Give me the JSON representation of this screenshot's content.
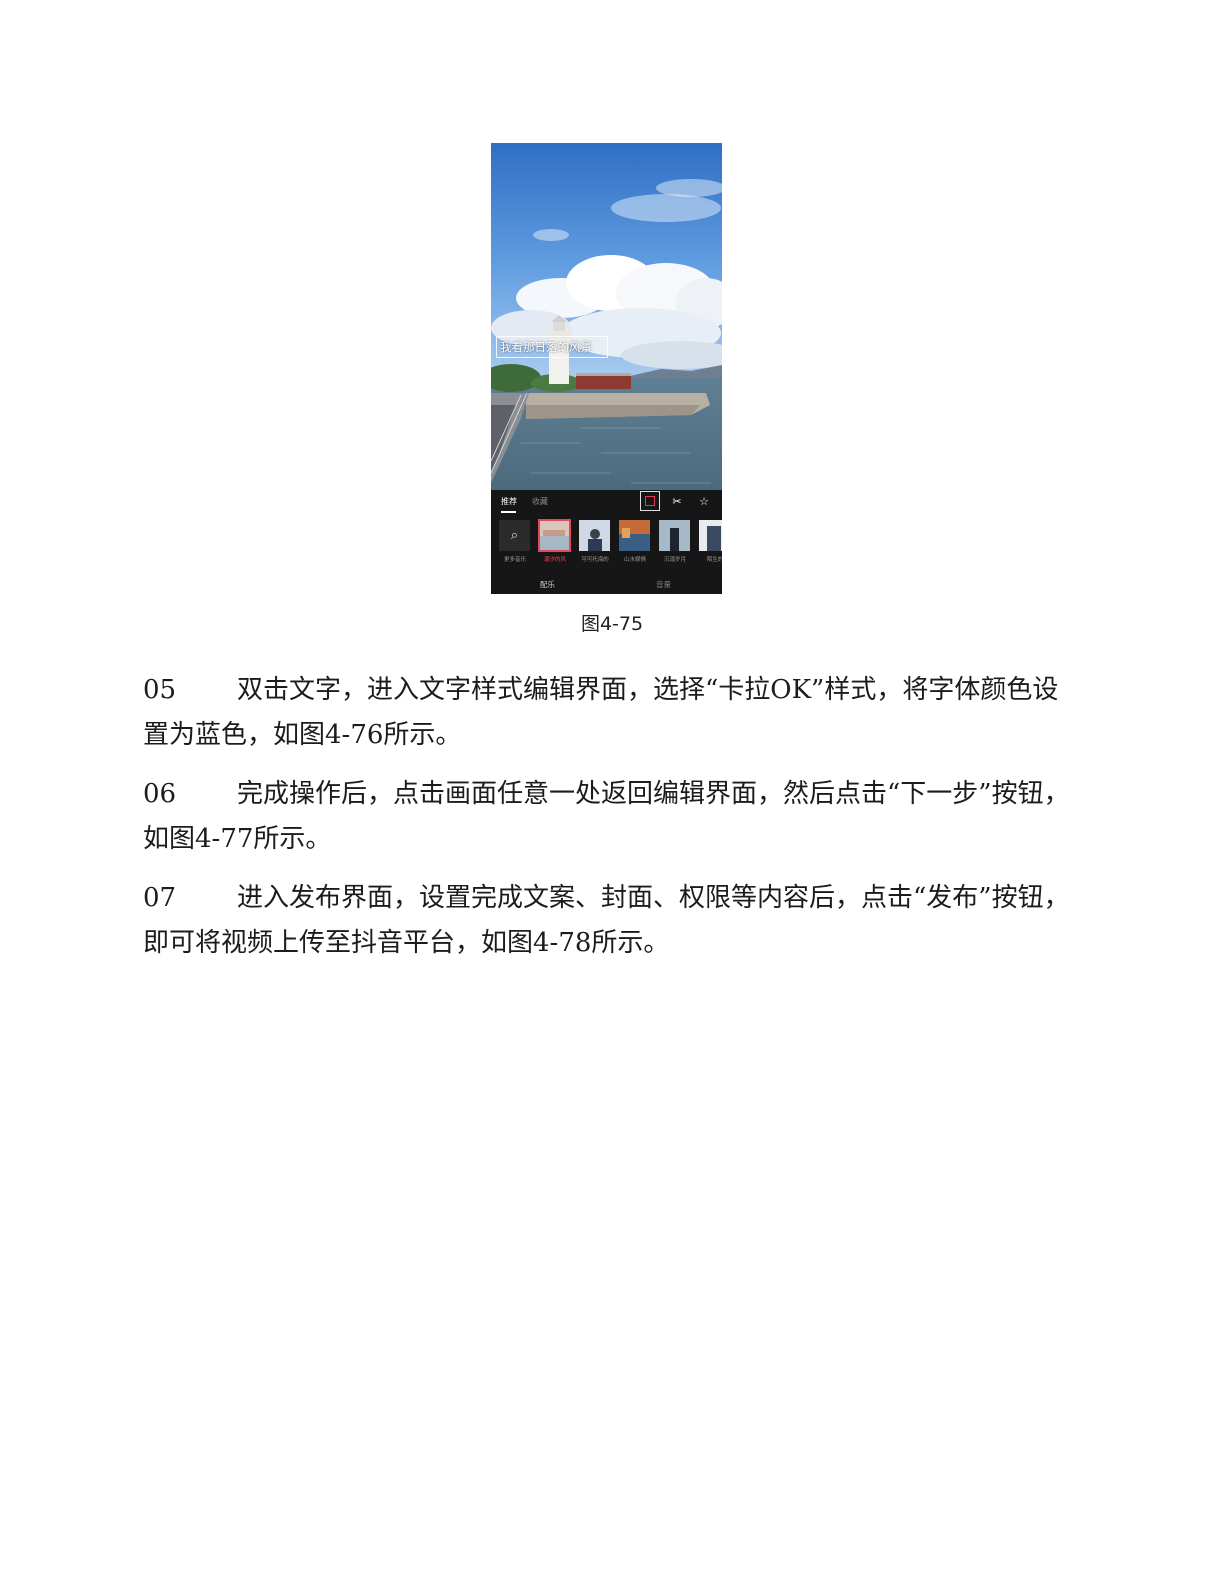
{
  "figure": {
    "caption": "图4-75",
    "screen": {
      "video_text": "我看那日落的风景",
      "tabs": [
        "推荐",
        "收藏"
      ],
      "tool_icons": [
        "color-icon",
        "scissors-icon",
        "star-icon"
      ],
      "music_items": [
        {
          "label": "更多音乐",
          "kind": "search"
        },
        {
          "label": "潮汐的风",
          "kind": "thumb",
          "selected": true
        },
        {
          "label": "可可托海的",
          "kind": "thumb"
        },
        {
          "label": "山水娱情",
          "kind": "thumb"
        },
        {
          "label": "沉溺岁月",
          "kind": "thumb"
        },
        {
          "label": "陌生的",
          "kind": "thumb"
        }
      ],
      "bottom_tabs": [
        "配乐",
        "音量"
      ],
      "accent_color": "#e24a5a"
    }
  },
  "paragraphs": [
    {
      "num": "05",
      "text": "双击文字，进入文字样式编辑界面，选择“卡拉OK”样式，将字体颜色设置为蓝色，如图4-76所示。"
    },
    {
      "num": "06",
      "text": "完成操作后，点击画面任意一处返回编辑界面，然后点击“下一步”按钮，如图4-77所示。"
    },
    {
      "num": "07",
      "text": "进入发布界面，设置完成文案、封面、权限等内容后，点击“发布”按钮，即可将视频上传至抖音平台，如图4-78所示。"
    }
  ]
}
